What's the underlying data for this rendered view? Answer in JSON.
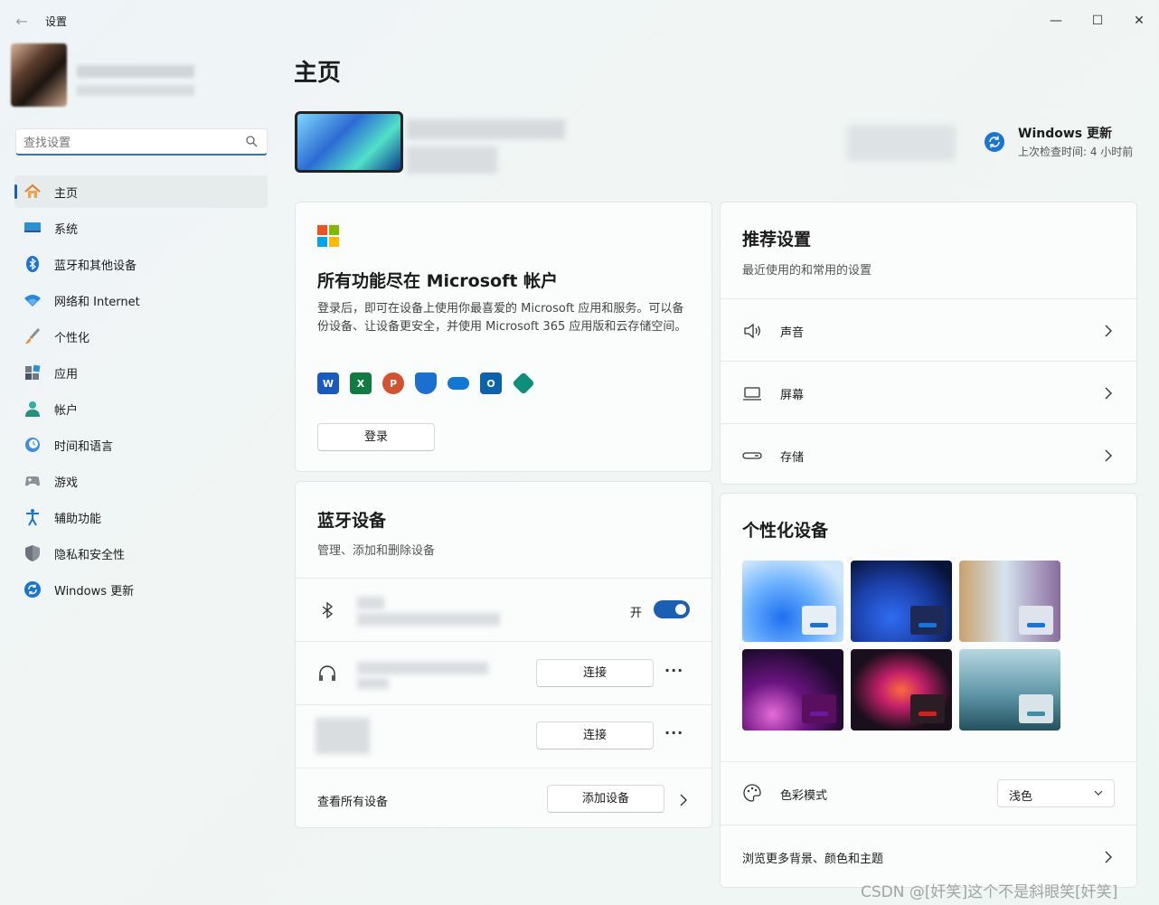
{
  "window": {
    "title": "设置",
    "min": "—",
    "max": "☐",
    "close": "✕"
  },
  "search": {
    "placeholder": "查找设置"
  },
  "sidebar": {
    "items": [
      {
        "label": "主页",
        "icon": "home-icon"
      },
      {
        "label": "系统",
        "icon": "monitor-icon"
      },
      {
        "label": "蓝牙和其他设备",
        "icon": "bluetooth-icon"
      },
      {
        "label": "网络和 Internet",
        "icon": "wifi-icon"
      },
      {
        "label": "个性化",
        "icon": "brush-icon"
      },
      {
        "label": "应用",
        "icon": "apps-icon"
      },
      {
        "label": "帐户",
        "icon": "person-icon"
      },
      {
        "label": "时间和语言",
        "icon": "clock-globe-icon"
      },
      {
        "label": "游戏",
        "icon": "gamepad-icon"
      },
      {
        "label": "辅助功能",
        "icon": "accessibility-icon"
      },
      {
        "label": "隐私和安全性",
        "icon": "shield-icon"
      },
      {
        "label": "Windows 更新",
        "icon": "update-icon"
      }
    ]
  },
  "main": {
    "title": "主页",
    "windows_update": {
      "title": "Windows 更新",
      "subtitle": "上次检查时间: 4 小时前"
    },
    "ms_account": {
      "title": "所有功能尽在 Microsoft 帐户",
      "description": "登录后，即可在设备上使用你最喜爱的 Microsoft 应用和服务。可以备份设备、让设备更安全，并使用 Microsoft 365 应用版和云存储空间。",
      "login_label": "登录"
    },
    "bluetooth": {
      "title": "蓝牙设备",
      "subtitle": "管理、添加和删除设备",
      "toggle_label": "开",
      "connect_label": "连接",
      "more_label": "···",
      "view_all_label": "查看所有设备",
      "add_device_label": "添加设备"
    },
    "recommended": {
      "title": "推荐设置",
      "subtitle": "最近使用的和常用的设置",
      "items": [
        {
          "label": "声音",
          "icon": "speaker-icon"
        },
        {
          "label": "屏幕",
          "icon": "laptop-icon"
        },
        {
          "label": "存储",
          "icon": "storage-icon"
        }
      ]
    },
    "personalize": {
      "title": "个性化设备",
      "color_mode_label": "色彩模式",
      "color_mode_value": "浅色",
      "browse_label": "浏览更多背景、颜色和主题"
    }
  },
  "colors": {
    "accent": "#1a5fb4",
    "bluetooth_toggle_on": "#1a5fb4"
  },
  "watermark": "CSDN @[奸笑]这个不是斜眼笑[奸笑]"
}
